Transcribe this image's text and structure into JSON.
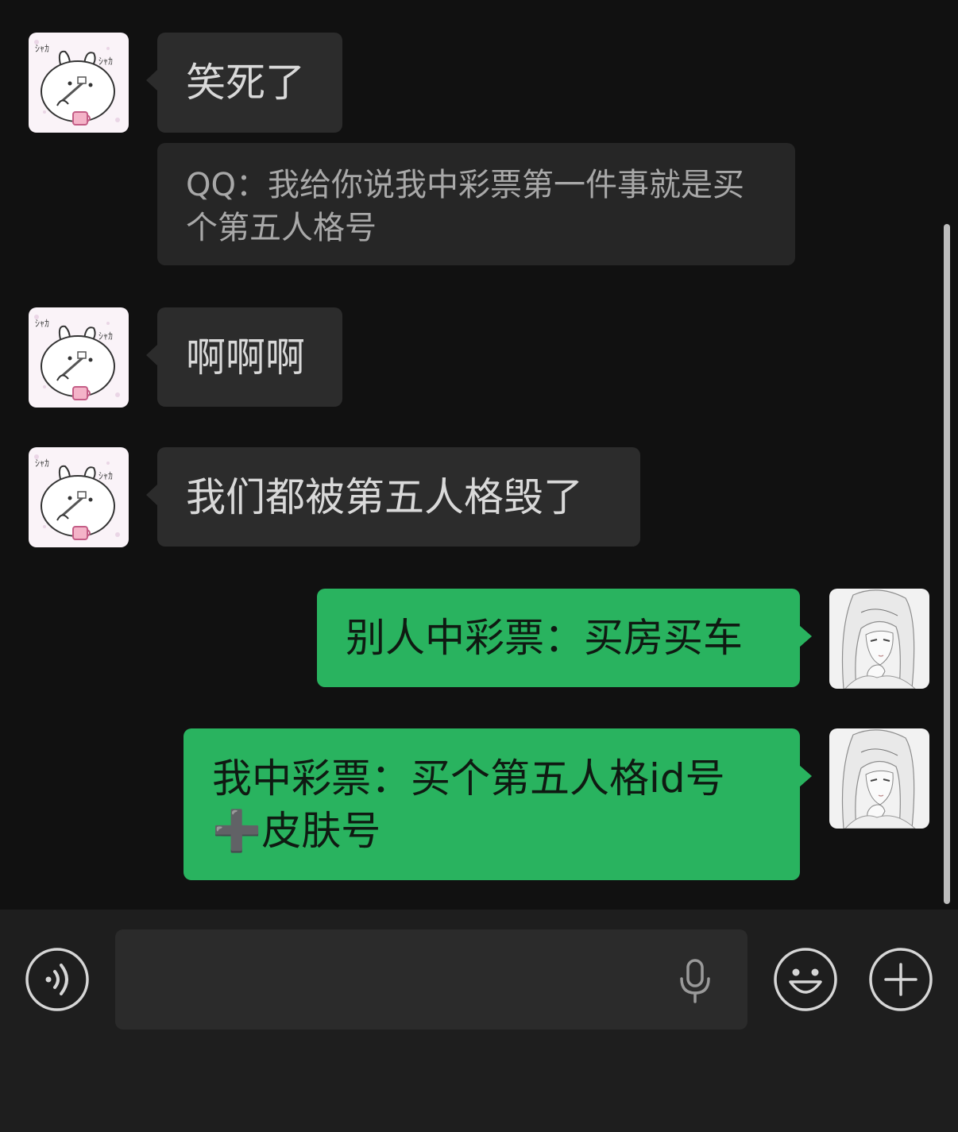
{
  "messages": [
    {
      "side": "in",
      "text": "笑死了"
    },
    {
      "side": "in-quote",
      "text": "QQ：我给你说我中彩票第一件事就是买个第五人格号"
    },
    {
      "side": "in",
      "text": "啊啊啊"
    },
    {
      "side": "in",
      "text": "我们都被第五人格毁了"
    },
    {
      "side": "out",
      "text": "别人中彩票：买房买车"
    },
    {
      "side": "out",
      "text": "我中彩票：买个第五人格id号\n➕皮肤号"
    }
  ],
  "avatars": {
    "contact": "cartoon-rabbit-avatar",
    "self": "sketch-girl-avatar"
  },
  "input": {
    "value": "",
    "voice_icon": "voice-icon",
    "mic_icon": "microphone-icon",
    "emoji_icon": "emoji-icon",
    "plus_icon": "plus-icon"
  },
  "colors": {
    "background": "#111111",
    "incoming_bubble": "#2c2c2c",
    "outgoing_bubble": "#29b35f",
    "input_bar": "#1e1e1e"
  }
}
